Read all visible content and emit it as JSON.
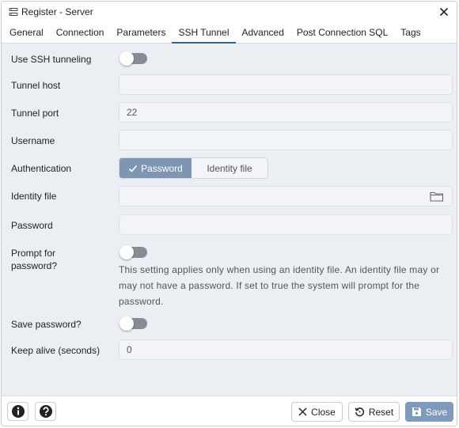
{
  "window": {
    "title": "Register - Server",
    "icon": "server-icon"
  },
  "tabs": [
    {
      "label": "General"
    },
    {
      "label": "Connection"
    },
    {
      "label": "Parameters"
    },
    {
      "label": "SSH Tunnel",
      "active": true
    },
    {
      "label": "Advanced"
    },
    {
      "label": "Post Connection SQL"
    },
    {
      "label": "Tags"
    }
  ],
  "form": {
    "use_ssh": {
      "label": "Use SSH tunneling",
      "value": false
    },
    "tunnel_host": {
      "label": "Tunnel host",
      "value": ""
    },
    "tunnel_port": {
      "label": "Tunnel port",
      "value": "22"
    },
    "username": {
      "label": "Username",
      "value": ""
    },
    "authentication": {
      "label": "Authentication",
      "options": [
        "Password",
        "Identity file"
      ],
      "selected": "Password"
    },
    "identity_file": {
      "label": "Identity file",
      "value": "",
      "icon": "folder-icon"
    },
    "password": {
      "label": "Password",
      "value": ""
    },
    "prompt_password": {
      "label_line1": "Prompt for",
      "label_line2": "password?",
      "value": false,
      "help_line1": "This setting applies only when using an identity file. An identity file may or",
      "help_line2": "may not have a password. If set to true the system will prompt for the",
      "help_line3": "password."
    },
    "save_password": {
      "label": "Save password?",
      "value": false
    },
    "keep_alive": {
      "label": "Keep alive (seconds)",
      "value": "0"
    }
  },
  "footer": {
    "info_icon": "info-icon",
    "help_icon": "help-icon",
    "close_label": "Close",
    "reset_label": "Reset",
    "save_label": "Save"
  },
  "colors": {
    "accent": "#326690",
    "panel_bg": "#ebeef3",
    "toggle_off": "#888c93",
    "segment_on": "#7e96b2",
    "save_disabled": "#7e9bbd"
  }
}
